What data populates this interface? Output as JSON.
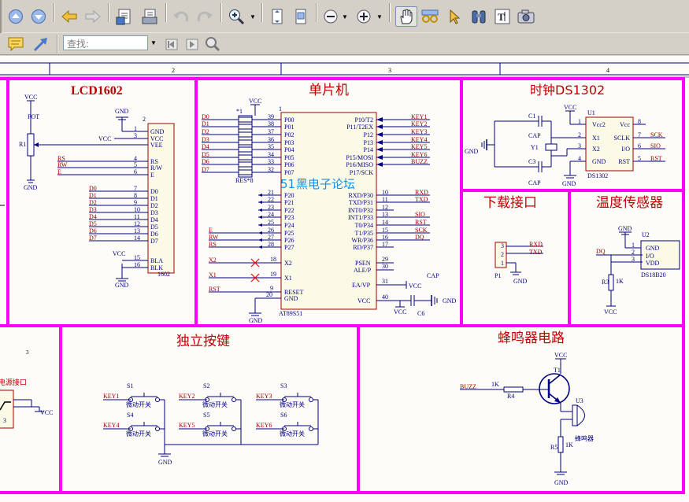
{
  "toolbar": {
    "search_placeholder": "查找:"
  },
  "icons": [
    "nav-up-icon",
    "nav-down-icon",
    "back-arrow-icon",
    "forward-arrow-icon",
    "save-icon",
    "print-icon",
    "undo-icon",
    "redo-icon",
    "zoom-in-icon",
    "fit-page-icon",
    "actual-size-icon",
    "zoom-out-icon",
    "zoom-plus-icon",
    "hand-tool-icon",
    "glasses-icon",
    "select-arrow-icon",
    "binoculars-icon",
    "text-select-icon",
    "snapshot-icon",
    "comment-icon",
    "arrow-tool-icon",
    "first-result-icon",
    "next-result-icon",
    "find-icon"
  ],
  "ruler": {
    "marks": [
      "2",
      "3",
      "4"
    ]
  },
  "schematic": {
    "sections": {
      "lcd": "LCD1602",
      "mcu": "单片机",
      "clock": "时钟DS1302",
      "download": "下载接口",
      "temp": "温度传感器",
      "keys": "独立按键",
      "buzzer": "蜂鸣器电路",
      "power": "电源接口",
      "section_num3": "3"
    },
    "watermark": {
      "prefix": "51",
      "rest": "黑电子论坛"
    },
    "lcd": {
      "vcc": "VCC",
      "pot": "POT",
      "r1": "R1",
      "gnd": "GND",
      "gnd_top": "GND",
      "vcc_left": "VCC",
      "pin2": "2",
      "pins_in": [
        "GND",
        "VCC",
        "VEE",
        "RS",
        "R/W",
        "E",
        "D0",
        "D1",
        "D2",
        "D3",
        "D4",
        "D5",
        "D6",
        "D7",
        "BLA",
        "BLK"
      ],
      "pin_nums": [
        "1",
        "2",
        "3",
        "4",
        "5",
        "6",
        "7",
        "8",
        "9",
        "10",
        "11",
        "12",
        "13",
        "14",
        "15",
        "16"
      ],
      "nets_left": [
        "RS",
        "RW",
        "E",
        "D0",
        "D1",
        "D2",
        "D3",
        "D4",
        "D5",
        "D6",
        "D7"
      ],
      "part": "1602",
      "vcc_bla": "VCC",
      "gnd_bottom": "GND"
    },
    "mcu": {
      "vcc": "VCC",
      "res_label": "*1",
      "res_part": "RES*8",
      "nets_left_top": [
        "D0",
        "D1",
        "D2",
        "D3",
        "D4",
        "D5",
        "D6",
        "D7"
      ],
      "p0_pins": [
        "P00",
        "P01",
        "P02",
        "P03",
        "P04",
        "P05",
        "P06",
        "P07"
      ],
      "p0_nums": [
        "39",
        "38",
        "37",
        "36",
        "35",
        "34",
        "33",
        "32"
      ],
      "p2_pins": [
        "P20",
        "P21",
        "P22",
        "P23",
        "P24",
        "P25",
        "P26",
        "P27"
      ],
      "p2_nums": [
        "21",
        "22",
        "23",
        "24",
        "25",
        "26",
        "27",
        "28"
      ],
      "nets_left_bot": [
        "E",
        "RW",
        "RS"
      ],
      "x2": "X2",
      "x1": "X1",
      "x2pin": "X2",
      "x1pin": "X1",
      "x2num": "18",
      "x1num": "19",
      "rst": "RST",
      "reset": "RESET",
      "gnd_pin": "GND",
      "rst_num": "9",
      "gnd_num": "20",
      "gnd_bottom": "GND",
      "part": "AT89S51",
      "num1": "1",
      "p1_pins": [
        "P10/T2",
        "P11/T2EX",
        "P12",
        "P13",
        "P14",
        "P15/MOSI",
        "P16/MISO",
        "P17/SCK"
      ],
      "p1_nets": [
        "KEY1",
        "KEY2",
        "KEY3",
        "KEY4",
        "KEY5",
        "KEY6",
        "BUZZ"
      ],
      "p3_pins": [
        "RXD/P30",
        "TXD/P31",
        "INT0/P32",
        "INT1/P33",
        "T0/P34",
        "T1/P35",
        "WR/P36",
        "RD/P37"
      ],
      "p3_nums": [
        "10",
        "11",
        "12",
        "13",
        "14",
        "15",
        "16",
        "17"
      ],
      "p3_nets": [
        "RXD",
        "TXD",
        "SIO",
        "RST",
        "SCK",
        "DQ"
      ],
      "psen": "PSEN",
      "ale": "ALE/P",
      "ea": "EA/VP",
      "vccpin": "VCC",
      "psen_num": "29",
      "ale_num": "30",
      "ea_num": "31",
      "vcc_num": "40",
      "ea_vcc": "VCC",
      "cap": "CAP",
      "c6": "C6",
      "vcc_c6": "VCC",
      "gnd_c6": "GND"
    },
    "clock": {
      "vcc": "VCC",
      "u1": "U1",
      "c1": "C1",
      "cap1": "CAP",
      "y1": "Y1",
      "c3": "C3",
      "cap3": "CAP",
      "gnd_left": "GND",
      "gnd_bottom": "GND",
      "pins_l": [
        "Vcc2",
        "X1",
        "X2",
        "GND"
      ],
      "pins_l_nums": [
        "1",
        "2",
        "3",
        "4"
      ],
      "pins_r": [
        "Vcc",
        "SCLK",
        "I/O",
        "RST"
      ],
      "pins_r_nums": [
        "8",
        "7",
        "6",
        "5"
      ],
      "nets_r": [
        "SCK",
        "SIO",
        "RST"
      ],
      "part": "DS1302"
    },
    "download": {
      "nets": [
        "RXD",
        "TXD"
      ],
      "pins": [
        "3",
        "2",
        "1"
      ],
      "part": "P1",
      "gnd": "GND"
    },
    "temp": {
      "gnd": "GND",
      "u2": "U2",
      "pins": [
        "GND",
        "I/O",
        "VDD"
      ],
      "nums": [
        "1",
        "2",
        "3"
      ],
      "dq": "DQ",
      "r3": "R3",
      "r3v": "1K",
      "vcc": "VCC",
      "part": "DS18B20"
    },
    "keys": {
      "switches": [
        {
          "net": "KEY1",
          "name": "S1",
          "label": "微动开关"
        },
        {
          "net": "KEY2",
          "name": "S2",
          "label": "微动开关"
        },
        {
          "net": "KEY3",
          "name": "S3",
          "label": "微动开关"
        },
        {
          "net": "KEY4",
          "name": "S4",
          "label": "微动开关"
        },
        {
          "net": "KEY5",
          "name": "S5",
          "label": "微动开关"
        },
        {
          "net": "KEY6",
          "name": "S6",
          "label": "微动开关"
        }
      ],
      "gnd": "GND"
    },
    "buzzer": {
      "vcc": "VCC",
      "t1": "T1",
      "buzz": "BUZZ",
      "r4v": "1K",
      "r4": "R4",
      "u3": "U3",
      "r5": "R5",
      "r5v": "1K",
      "gnd": "GND",
      "part": "蜂鸣器"
    },
    "power": {
      "vcc": "VCC",
      "pin3": "3"
    }
  },
  "colors": {
    "frame": "#ff00ff",
    "wire": "#000080",
    "net": "#a00000",
    "part": "#000080",
    "title": "#c00000"
  }
}
